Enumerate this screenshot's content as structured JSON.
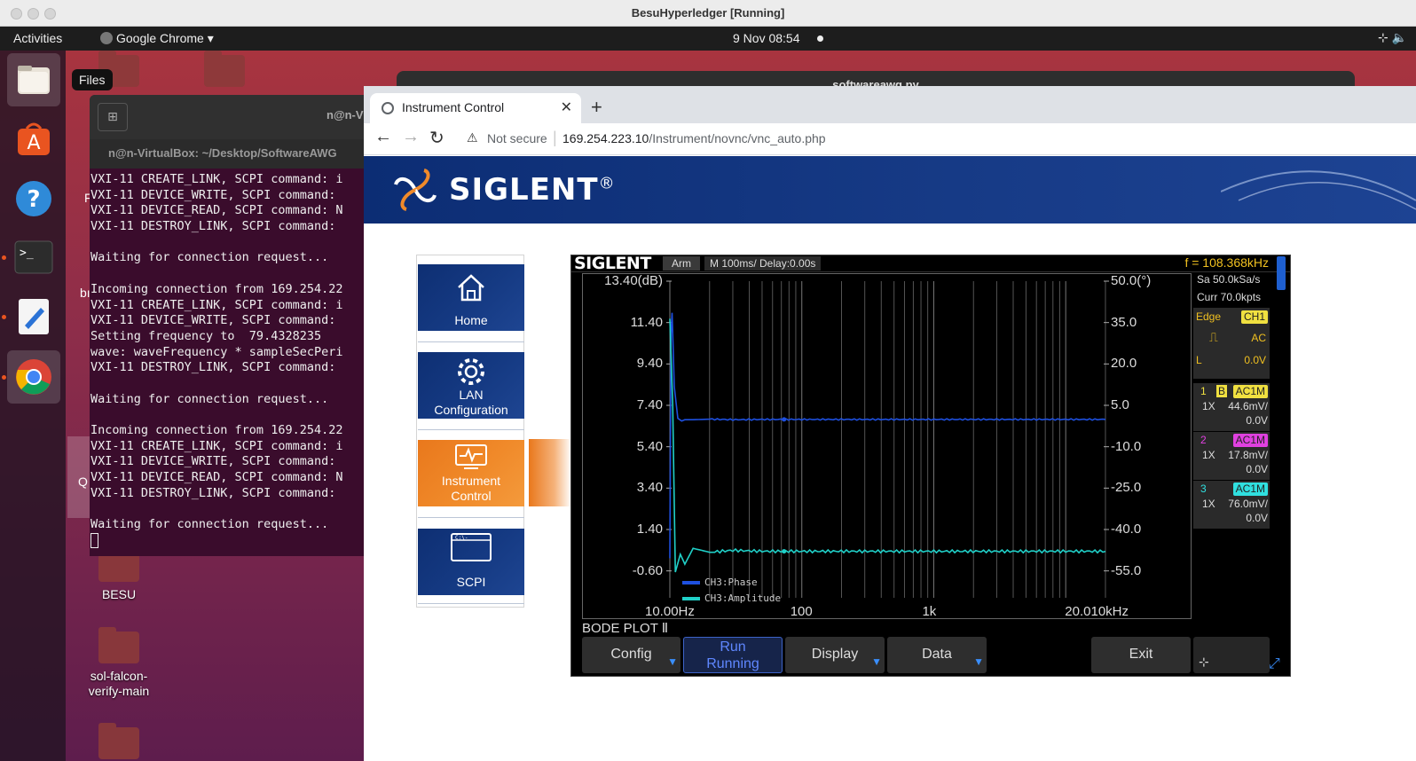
{
  "vbox": {
    "title": "BesuHyperledger [Running]"
  },
  "topbar": {
    "activities": "Activities",
    "app": "Google Chrome ▾",
    "clock": "9 Nov  08:54",
    "tray_icons": [
      "network-icon",
      "volume-icon"
    ]
  },
  "dock": {
    "tooltip": "Files",
    "items": [
      {
        "name": "files",
        "running": false
      },
      {
        "name": "ubuntu-software",
        "running": false
      },
      {
        "name": "help",
        "running": false
      },
      {
        "name": "terminal",
        "running": true
      },
      {
        "name": "text-editor",
        "running": true
      },
      {
        "name": "google-chrome",
        "running": true
      }
    ]
  },
  "desktop": {
    "icons": [
      {
        "label": "BESU"
      },
      {
        "label": "sol-falcon-\nverify-main"
      }
    ],
    "partial_labels": [
      "F",
      "bı",
      "Q"
    ]
  },
  "bg_window": {
    "title": "softwareawg.py"
  },
  "terminal": {
    "header_title": "n@n-V",
    "title": "n@n-VirtualBox: ~/Desktop/SoftwareAWG",
    "lines": [
      "VXI-11 CREATE_LINK, SCPI command: i",
      "VXI-11 DEVICE_WRITE, SCPI command: ",
      "VXI-11 DEVICE_READ, SCPI command: N",
      "VXI-11 DESTROY_LINK, SCPI command: ",
      "",
      "Waiting for connection request...",
      "",
      "Incoming connection from 169.254.22",
      "VXI-11 CREATE_LINK, SCPI command: i",
      "VXI-11 DEVICE_WRITE, SCPI command: ",
      "Setting frequency to  79.4328235",
      "wave: waveFrequency * sampleSecPeri",
      "VXI-11 DESTROY_LINK, SCPI command: ",
      "",
      "Waiting for connection request...",
      "",
      "Incoming connection from 169.254.22",
      "VXI-11 CREATE_LINK, SCPI command: i",
      "VXI-11 DEVICE_WRITE, SCPI command: ",
      "VXI-11 DEVICE_READ, SCPI command: N",
      "VXI-11 DESTROY_LINK, SCPI command: ",
      "",
      "Waiting for connection request..."
    ]
  },
  "chrome": {
    "tab_title": "Instrument Control",
    "not_secure": "Not secure",
    "url_host": "169.254.223.10",
    "url_path": "/Instrument/novnc/vnc_auto.php"
  },
  "siglent": {
    "brand": "SIGLENT",
    "registered": "®",
    "nav": [
      {
        "label": "Home",
        "active": false
      },
      {
        "label": "LAN\nConfiguration",
        "active": false
      },
      {
        "label": "Instrument\nControl",
        "active": true
      },
      {
        "label": "SCPI",
        "active": false
      }
    ]
  },
  "scope": {
    "brand": "SIGLENT",
    "arm": "Arm",
    "timebase": "M 100ms/  Delay:0.00s",
    "freq": "f = 108.368kHz",
    "sample_rate": "Sa 50.0kSa/s",
    "curr": "Curr 70.0kpts",
    "trigger": {
      "label": "Edge",
      "source": "CH1",
      "coupling": "AC",
      "level_label": "L",
      "level": "0.0V"
    },
    "channels": [
      {
        "num": "1",
        "flag": "B",
        "coupling": "AC1M",
        "probe": "1X",
        "scale": "44.6mV/",
        "offset": "0.0V",
        "color": "#f0e040"
      },
      {
        "num": "2",
        "flag": "",
        "coupling": "AC1M",
        "probe": "1X",
        "scale": "17.8mV/",
        "offset": "0.0V",
        "color": "#e040e0"
      },
      {
        "num": "3",
        "flag": "",
        "coupling": "AC1M",
        "probe": "1X",
        "scale": "76.0mV/",
        "offset": "0.0V",
        "color": "#30e0e0"
      }
    ],
    "mode_label": "BODE PLOT Ⅱ",
    "softkeys": [
      {
        "label": "Config",
        "sub": "",
        "arrow": true
      },
      {
        "label": "Run",
        "sub": "Running",
        "arrow": false
      },
      {
        "label": "Display",
        "sub": "",
        "arrow": true
      },
      {
        "label": "Data",
        "sub": "",
        "arrow": true
      },
      {
        "label": "Exit",
        "sub": "",
        "arrow": false
      }
    ]
  },
  "chart_data": {
    "type": "line",
    "title": "",
    "xlabel": "",
    "ylabel": "",
    "x_scale": "log",
    "xlim": [
      10,
      20010
    ],
    "x_tick_labels": [
      "10.00Hz",
      "100",
      "1k",
      "20.010kHz"
    ],
    "y_left_ticks": [
      "13.40(dB)",
      "11.40",
      "9.40",
      "7.40",
      "5.40",
      "3.40",
      "1.40",
      "-0.60"
    ],
    "y_left_lim": [
      -2.6,
      13.4
    ],
    "y_right_ticks": [
      "50.0(°)",
      "35.0",
      "20.0",
      "5.0",
      "-10.0",
      "-25.0",
      "-40.0",
      "-55.0"
    ],
    "y_right_lim": [
      -70,
      50
    ],
    "grid": true,
    "legend": "bottom-left",
    "series": [
      {
        "name": "CH3:Phase",
        "axis": "right",
        "color": "#1e50e0",
        "x": [
          10,
          10.2,
          10.4,
          10.8,
          11.5,
          12.3,
          13,
          15,
          20,
          30,
          50,
          100,
          300,
          1000,
          3000,
          10000,
          20010
        ],
        "values": [
          -55,
          30,
          38,
          10,
          -2,
          -3,
          -2.5,
          -2.5,
          -2.3,
          -2.5,
          -2.4,
          -2.4,
          -2.4,
          -2.4,
          -2.4,
          -2.4,
          -2.4
        ]
      },
      {
        "name": "CH3:Amplitude",
        "axis": "left",
        "color": "#20d0c8",
        "x": [
          10,
          10.5,
          11,
          12,
          13,
          15,
          20,
          30,
          50,
          100,
          300,
          1000,
          3000,
          10000,
          20010
        ],
        "values": [
          11.5,
          7.2,
          -1.3,
          -0.4,
          -0.9,
          -0.1,
          -0.3,
          -0.2,
          -0.25,
          -0.25,
          -0.25,
          -0.25,
          -0.25,
          -0.25,
          -0.25
        ]
      }
    ]
  }
}
